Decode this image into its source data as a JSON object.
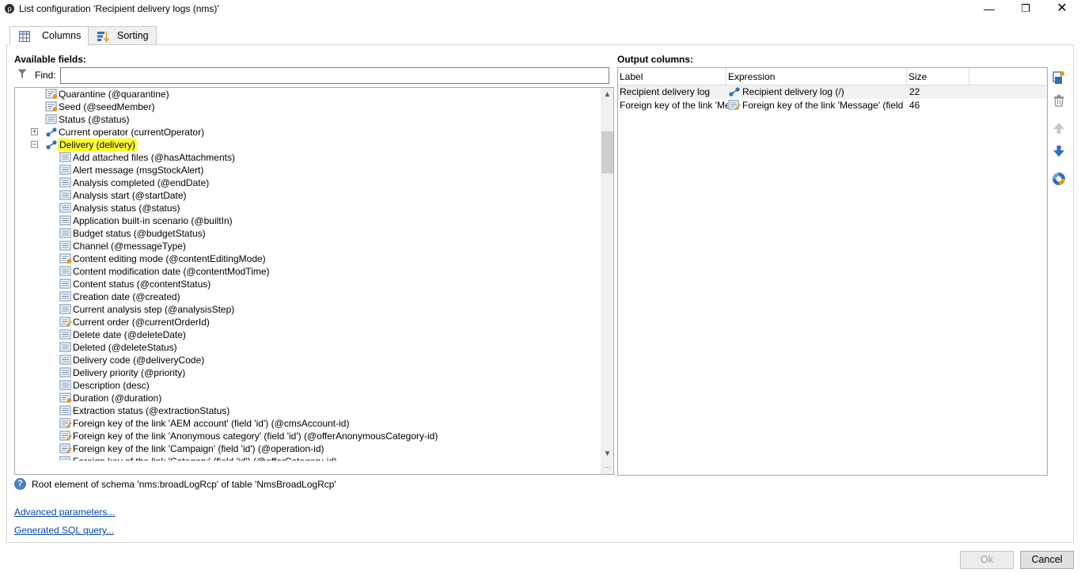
{
  "window": {
    "title": "List configuration 'Recipient delivery logs (nms)'",
    "app_icon": "adobe-campaign-icon",
    "controls": {
      "minimize": "—",
      "maximize": "❐",
      "close": "✕"
    }
  },
  "tabs": [
    {
      "label": "Columns",
      "icon": "grid-icon",
      "active": true
    },
    {
      "label": "Sorting",
      "icon": "sort-icon",
      "active": false
    }
  ],
  "available": {
    "heading": "Available fields:",
    "find_label": "Find:",
    "find_value": "",
    "tree": [
      {
        "text": "Quarantine (@quarantine)",
        "icon": "field-enum",
        "level": 0
      },
      {
        "text": "Seed (@seedMember)",
        "icon": "field-enum",
        "level": 0
      },
      {
        "text": "Status (@status)",
        "icon": "field",
        "level": 0
      },
      {
        "text": "Current operator (currentOperator)",
        "icon": "link",
        "level": 0,
        "expander": "+"
      },
      {
        "text": "Delivery (delivery)",
        "icon": "link",
        "level": 0,
        "expander": "−",
        "highlight": true
      },
      {
        "text": "Add attached files (@hasAttachments)",
        "icon": "field",
        "level": 1
      },
      {
        "text": "Alert message (msgStockAlert)",
        "icon": "field",
        "level": 1
      },
      {
        "text": "Analysis completed (@endDate)",
        "icon": "field",
        "level": 1
      },
      {
        "text": "Analysis start (@startDate)",
        "icon": "field",
        "level": 1
      },
      {
        "text": "Analysis status (@status)",
        "icon": "field",
        "level": 1
      },
      {
        "text": "Application built-in scenario (@builtIn)",
        "icon": "field",
        "level": 1
      },
      {
        "text": "Budget status (@budgetStatus)",
        "icon": "field",
        "level": 1
      },
      {
        "text": "Channel (@messageType)",
        "icon": "field",
        "level": 1
      },
      {
        "text": "Content editing mode (@contentEditingMode)",
        "icon": "field-enum",
        "level": 1
      },
      {
        "text": "Content modification date (@contentModTime)",
        "icon": "field",
        "level": 1
      },
      {
        "text": "Content status (@contentStatus)",
        "icon": "field",
        "level": 1
      },
      {
        "text": "Creation date (@created)",
        "icon": "field",
        "level": 1
      },
      {
        "text": "Current analysis step (@analysisStep)",
        "icon": "field",
        "level": 1
      },
      {
        "text": "Current order (@currentOrderId)",
        "icon": "field-key",
        "level": 1
      },
      {
        "text": "Delete date (@deleteDate)",
        "icon": "field",
        "level": 1
      },
      {
        "text": "Deleted (@deleteStatus)",
        "icon": "field",
        "level": 1
      },
      {
        "text": "Delivery code (@deliveryCode)",
        "icon": "field",
        "level": 1
      },
      {
        "text": "Delivery priority (@priority)",
        "icon": "field",
        "level": 1
      },
      {
        "text": "Description (desc)",
        "icon": "field",
        "level": 1
      },
      {
        "text": "Duration (@duration)",
        "icon": "field-enum",
        "level": 1
      },
      {
        "text": "Extraction status (@extractionStatus)",
        "icon": "field",
        "level": 1
      },
      {
        "text": "Foreign key of the link 'AEM account' (field 'id') (@cmsAccount-id)",
        "icon": "field-key",
        "level": 1
      },
      {
        "text": "Foreign key of the link 'Anonymous category' (field 'id') (@offerAnonymousCategory-id)",
        "icon": "field-key",
        "level": 1
      },
      {
        "text": "Foreign key of the link 'Campaign' (field 'id') (@operation-id)",
        "icon": "field-key",
        "level": 1
      },
      {
        "text": "Foreign key of the link 'Category' (field 'id') (@offerCategory-id)",
        "icon": "field-key",
        "level": 1
      }
    ]
  },
  "output": {
    "heading": "Output columns:",
    "columns": [
      "Label",
      "Expression",
      "Size"
    ],
    "rows": [
      {
        "label": "Recipient delivery log",
        "expression": "Recipient delivery log (/)",
        "expr_icon": "link",
        "size": "22",
        "selected": true
      },
      {
        "label": "Foreign key of the link 'Message' (field 'id')",
        "expression": "Foreign key of the link 'Message' (field 'id')",
        "expr_icon": "field-key",
        "size": "46",
        "selected": false
      }
    ],
    "side_buttons": [
      "add-expression-icon",
      "trash-icon",
      "arrow-up-icon",
      "arrow-down-icon",
      "distribution-icon"
    ]
  },
  "footer": {
    "info": "Root element of schema 'nms:broadLogRcp' of table 'NmsBroadLogRcp'",
    "advanced_link": "Advanced parameters...",
    "sql_link": "Generated SQL query...",
    "ok": "Ok",
    "cancel": "Cancel"
  },
  "colors": {
    "highlight": "#ffff2d",
    "link": "#0645ad",
    "icon_blue": "#2f6fbd"
  }
}
